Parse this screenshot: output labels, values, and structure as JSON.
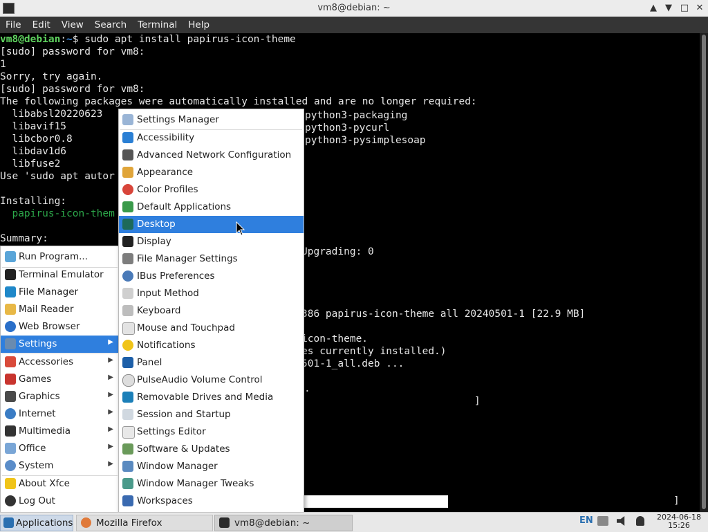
{
  "window": {
    "title": "vm8@debian: ~",
    "minimize": "▲",
    "maximize": "▼",
    "restore": "□",
    "close": "✕"
  },
  "menubar": {
    "file": "File",
    "edit": "Edit",
    "view": "View",
    "search": "Search",
    "terminal": "Terminal",
    "help": "Help"
  },
  "terminal": {
    "prompt_user": "vm8@debian",
    "prompt_sep": ":",
    "prompt_path": "~",
    "command": "$ sudo apt install papirus-icon-theme",
    "line2": "[sudo] password for vm8:",
    "line3": "1",
    "line4": "Sorry, try again.",
    "line5": "[sudo] password for vm8:",
    "line6": "The following packages were automatically installed and are no longer required:",
    "pkg_l1": "  libabsl20220623",
    "pkg_l2": "  libavif15",
    "pkg_l3": "  libcbor0.8",
    "pkg_l4": "  libdav1d6",
    "pkg_l5": "  libfuse2",
    "pkg_r1": "python3-packaging",
    "pkg_r2": "python3-pycurl",
    "pkg_r3": "python3-pysimplesoap",
    "line_use": "Use 'sudo apt autor",
    "installing": "Installing:",
    "installing_pkg": "  papirus-icon-them",
    "summary": "Summary:",
    "upgrading": "Upgrading: 0",
    "get_line": "386 papirus-icon-theme all 20240501-1 [22.9 MB]",
    "sel_line": "icon-theme.",
    "inst_line": "es currently installed.)",
    "unpack_line": "501-1_all.deb ...",
    "dot_line": ".",
    "bracket_mid": "]",
    "bracket_end": "]"
  },
  "app_menu": {
    "run_program": "Run Program...",
    "terminal_emulator": "Terminal Emulator",
    "file_manager": "File Manager",
    "mail_reader": "Mail Reader",
    "web_browser": "Web Browser",
    "settings": "Settings",
    "accessories": "Accessories",
    "games": "Games",
    "graphics": "Graphics",
    "internet": "Internet",
    "multimedia": "Multimedia",
    "office": "Office",
    "system": "System",
    "about_xfce": "About Xfce",
    "log_out": "Log Out",
    "submenu_arrow": "▶"
  },
  "settings_menu": {
    "settings_manager": "Settings Manager",
    "accessibility": "Accessibility",
    "advanced_network": "Advanced Network Configuration",
    "appearance": "Appearance",
    "color_profiles": "Color Profiles",
    "default_applications": "Default Applications",
    "desktop": "Desktop",
    "display": "Display",
    "file_manager_settings": "File Manager Settings",
    "ibus_preferences": "IBus Preferences",
    "input_method": "Input Method",
    "keyboard": "Keyboard",
    "mouse_touchpad": "Mouse and Touchpad",
    "notifications": "Notifications",
    "panel": "Panel",
    "pulseaudio": "PulseAudio Volume Control",
    "removable_drives": "Removable Drives and Media",
    "session_startup": "Session and Startup",
    "settings_editor": "Settings Editor",
    "software_updates": "Software & Updates",
    "window_manager": "Window Manager",
    "window_manager_tweaks": "Window Manager Tweaks",
    "workspaces": "Workspaces"
  },
  "taskbar": {
    "applications": "Applications",
    "firefox": "Mozilla Firefox",
    "terminal": "vm8@debian: ~",
    "keyboard_layout": "EN",
    "date": "2024-06-18",
    "time": "15:26"
  },
  "colors": {
    "selection": "#2f7fde",
    "prompt_user": "#5fd35f",
    "prompt_path": "#3b8ce0",
    "pkg_new": "#2ca84a"
  }
}
